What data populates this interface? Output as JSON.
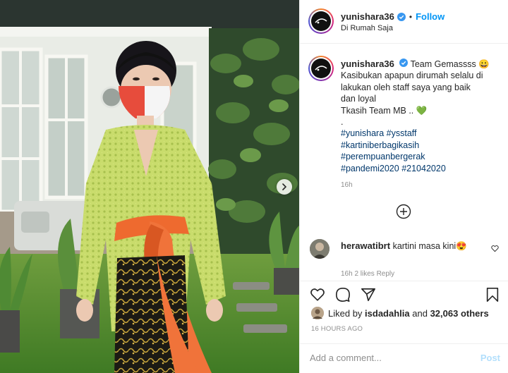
{
  "post": {
    "username": "yunishara36",
    "follow_label": "Follow",
    "separator": "•",
    "location": "Di Rumah Saja"
  },
  "caption": {
    "username": "yunishara36",
    "lines": [
      "Team Gemassss 😀",
      "Kasibukan apapun dirumah selalu di",
      "lakukan oleh staff saya yang baik",
      "dan loyal",
      "Tkasih Team MB .. 💚",
      "."
    ],
    "hashtag_lines": [
      [
        "#yunishara",
        "#ysstaff"
      ],
      [
        "#kartiniberbagikasih"
      ],
      [
        "#perempuanbergerak"
      ],
      [
        "#pandemi2020",
        "#21042020"
      ]
    ],
    "time": "16h"
  },
  "comments": [
    {
      "username": "herawatibrt",
      "text": "kartini masa kini😍"
    }
  ],
  "comment_cutoff": "16h   2 likes   Reply",
  "likes": {
    "prefix": "Liked by",
    "liker": "isdadahlia",
    "middle": "and",
    "count": "32,063 others"
  },
  "timestamp": "16 HOURS AGO",
  "comment_input": {
    "placeholder": "Add a comment..."
  },
  "post_button": "Post",
  "icons": [
    "verified-badge-icon",
    "heart-icon",
    "comment-icon",
    "share-icon",
    "bookmark-icon",
    "plus-circle-icon",
    "chevron-right-icon"
  ],
  "colors": {
    "accent": "#0095f6",
    "hashtag": "#00376b",
    "muted": "#8e8e8e",
    "border": "#efefef",
    "post_disabled": "#b2dffc"
  }
}
